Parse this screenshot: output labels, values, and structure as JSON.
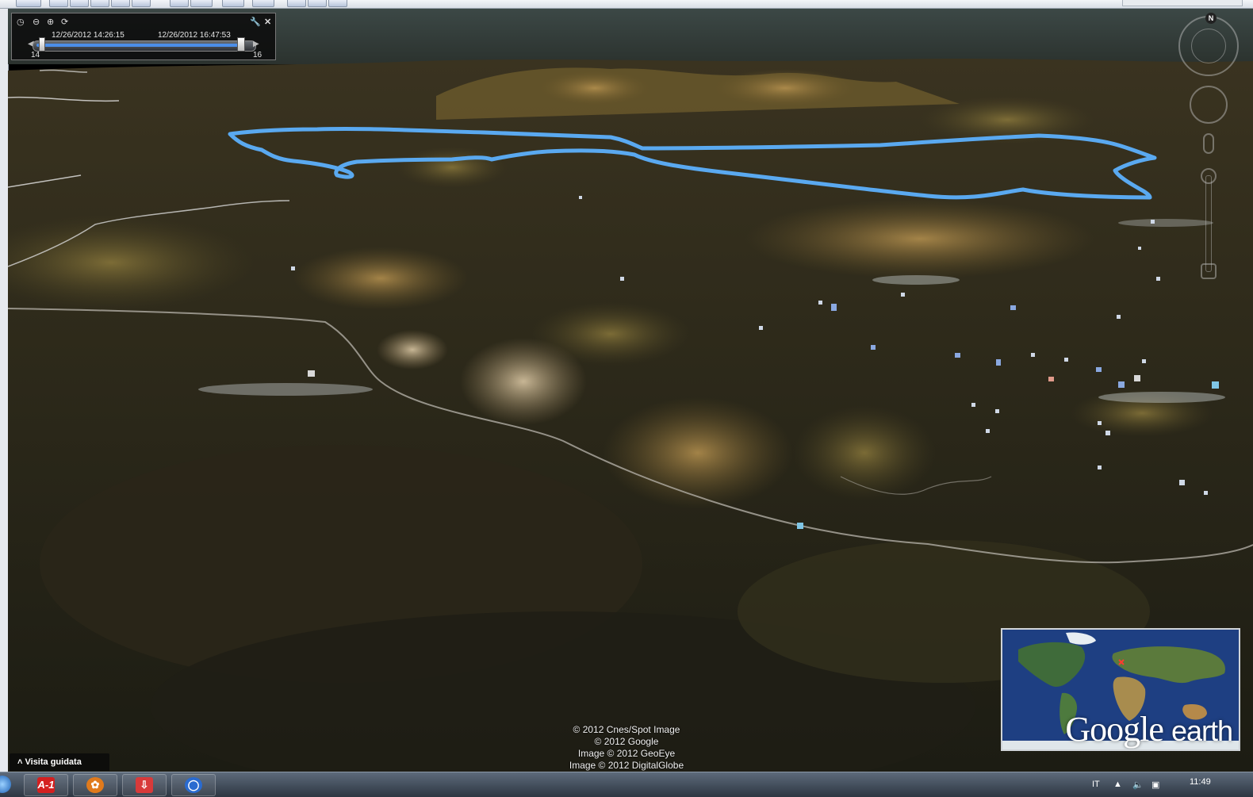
{
  "time_slider": {
    "start_time": "12/26/2012  14:26:15",
    "end_time": "12/26/2012  16:47:53",
    "tick_start": "14",
    "tick_end": "16"
  },
  "navigation": {
    "north_label": "N"
  },
  "attribution": {
    "lines": [
      "© 2012 Cnes/Spot Image",
      "© 2012 Google",
      "Image © 2012 GeoEye",
      "Image © 2012 DigitalGlobe"
    ]
  },
  "overview_map": {
    "logo_main": "Google",
    "logo_suffix": "earth"
  },
  "tour": {
    "label": "Visita guidata",
    "icon": "chevron-up-icon"
  },
  "taskbar": {
    "apps": [
      {
        "name": "start-orb",
        "icon": "windows-orb-icon"
      },
      {
        "name": "app-1",
        "icon": "app-icon",
        "glyph": "A-1"
      },
      {
        "name": "app-2",
        "icon": "paw-icon"
      },
      {
        "name": "app-3",
        "icon": "download-icon"
      },
      {
        "name": "app-4",
        "icon": "globe-icon"
      }
    ],
    "language": "IT",
    "clock": "11:49"
  },
  "colors": {
    "track_line": "#5aa9f0",
    "road_line": "#c9c9c9",
    "terrain_dark": "#2a2617",
    "terrain_light": "#8a7238"
  }
}
